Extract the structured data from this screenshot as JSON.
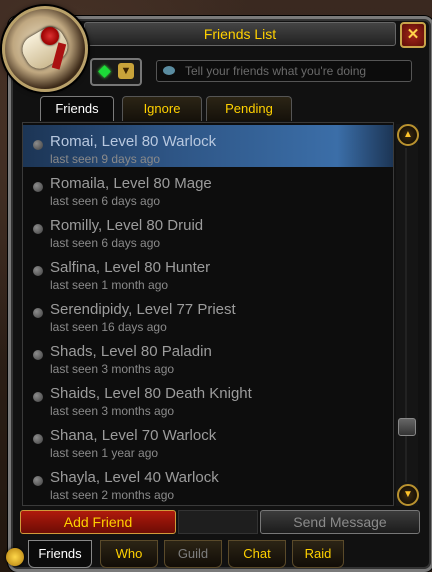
{
  "window": {
    "title": "Friends List",
    "close": "✕"
  },
  "status": {
    "arrow": "▼"
  },
  "broadcast": {
    "placeholder": "Tell your friends what you're doing"
  },
  "tabs": [
    {
      "label": "Friends",
      "active": true
    },
    {
      "label": "Ignore",
      "active": false
    },
    {
      "label": "Pending",
      "active": false
    }
  ],
  "friends": [
    {
      "name": "Romai, Level 80 Warlock",
      "seen": "last seen 9 days ago",
      "selected": true
    },
    {
      "name": "Romaila, Level 80 Mage",
      "seen": "last seen 6 days ago"
    },
    {
      "name": "Romilly, Level 80 Druid",
      "seen": "last seen 6 days ago"
    },
    {
      "name": "Salfina, Level 80 Hunter",
      "seen": "last seen 1 month ago"
    },
    {
      "name": "Serendipidy, Level 77 Priest",
      "seen": "last seen 16 days ago"
    },
    {
      "name": "Shads, Level 80 Paladin",
      "seen": "last seen 3 months ago"
    },
    {
      "name": "Shaids, Level 80 Death Knight",
      "seen": "last seen 3 months ago"
    },
    {
      "name": "Shana, Level 70 Warlock",
      "seen": "last seen 1 year ago"
    },
    {
      "name": "Shayla, Level 40 Warlock",
      "seen": "last seen 2 months ago"
    }
  ],
  "scroll": {
    "up": "▲",
    "down": "▼",
    "position_fraction": 0.85
  },
  "buttons": {
    "add_friend": "Add Friend",
    "send_message": "Send Message"
  },
  "bottom_tabs": [
    {
      "label": "Friends",
      "state": "active"
    },
    {
      "label": "Who",
      "state": "normal"
    },
    {
      "label": "Guild",
      "state": "disabled"
    },
    {
      "label": "Chat",
      "state": "normal"
    },
    {
      "label": "Raid",
      "state": "normal"
    }
  ],
  "colors": {
    "title_gold": "#ffd100",
    "selected_row": "#2e5585",
    "online_green": "#1cdb38"
  }
}
